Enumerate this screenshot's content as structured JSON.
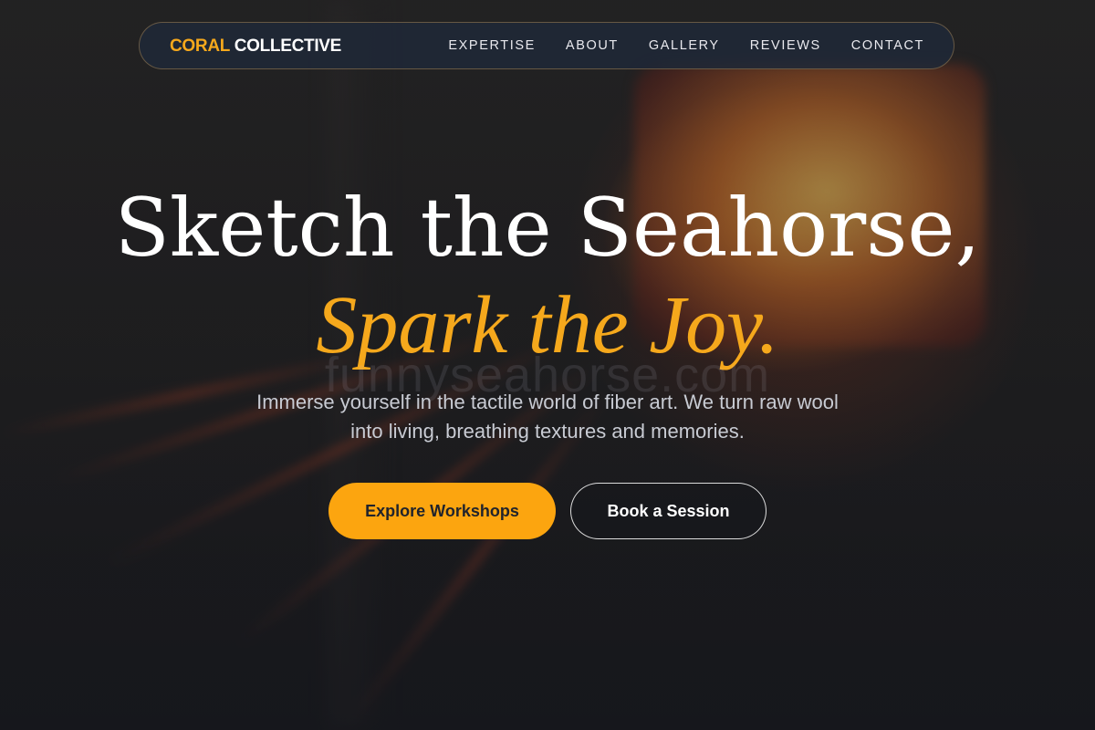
{
  "nav": {
    "brand_accent": "CORAL",
    "brand_main": "COLLECTIVE",
    "links": [
      "EXPERTISE",
      "ABOUT",
      "GALLERY",
      "REVIEWS",
      "CONTACT"
    ]
  },
  "hero": {
    "headline": "Sketch the Seahorse,",
    "headline_accent": "Spark the Joy.",
    "watermark": "funnyseahorse.com",
    "subtext": "Immerse yourself in the tactile world of fiber art. We turn raw wool into living, breathing textures and memories.",
    "primary_button": "Explore Workshops",
    "secondary_button": "Book a Session"
  },
  "colors": {
    "accent": "#f5a81c",
    "button_primary": "#fca50f",
    "nav_background": "#1e2837"
  }
}
